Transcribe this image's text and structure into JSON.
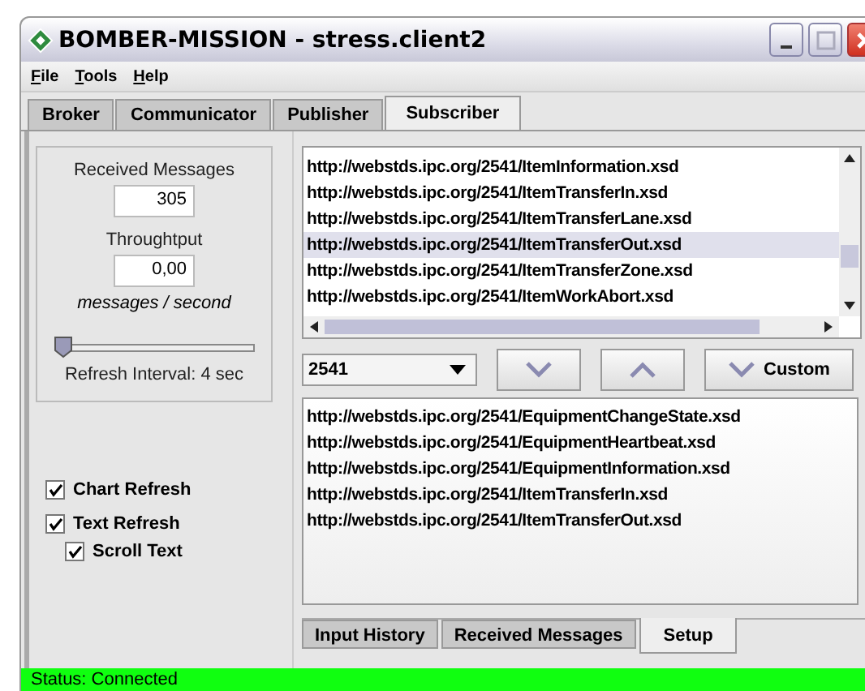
{
  "window": {
    "title": "BOMBER-MISSION - stress.client2"
  },
  "menu": [
    {
      "label": "File"
    },
    {
      "label": "Tools"
    },
    {
      "label": "Help"
    }
  ],
  "tabs": [
    {
      "label": "Broker",
      "selected": false
    },
    {
      "label": "Communicator",
      "selected": false
    },
    {
      "label": "Publisher",
      "selected": false
    },
    {
      "label": "Subscriber",
      "selected": true
    }
  ],
  "stats": {
    "received_label": "Received Messages",
    "received_value": "305",
    "throughput_label": "Throughtput",
    "throughput_value": "0,00",
    "unit": "messages / second",
    "refresh_slider": {
      "level": 0.0
    },
    "refresh_label": "Refresh Interval: 4 sec"
  },
  "options": [
    {
      "label": "Chart Refresh",
      "checked": true,
      "nested": false
    },
    {
      "label": "Text Refresh",
      "checked": true,
      "nested": false
    },
    {
      "label": "Scroll Text",
      "checked": true,
      "nested": true
    }
  ],
  "schema_list": [
    {
      "text": "http://webstds.ipc.org/2541/ItemInformation.xsd",
      "selected": false
    },
    {
      "text": "http://webstds.ipc.org/2541/ItemTransferIn.xsd",
      "selected": false
    },
    {
      "text": "http://webstds.ipc.org/2541/ItemTransferLane.xsd",
      "selected": false
    },
    {
      "text": "http://webstds.ipc.org/2541/ItemTransferOut.xsd",
      "selected": true
    },
    {
      "text": "http://webstds.ipc.org/2541/ItemTransferZone.xsd",
      "selected": false
    },
    {
      "text": "http://webstds.ipc.org/2541/ItemWorkAbort.xsd",
      "selected": false
    }
  ],
  "standard_dropdown": {
    "value": "2541"
  },
  "custom_button": {
    "label": "Custom"
  },
  "subscribed_list": [
    "http://webstds.ipc.org/2541/EquipmentChangeState.xsd",
    "http://webstds.ipc.org/2541/EquipmentHeartbeat.xsd",
    "http://webstds.ipc.org/2541/EquipmentInformation.xsd",
    "http://webstds.ipc.org/2541/ItemTransferIn.xsd",
    "http://webstds.ipc.org/2541/ItemTransferOut.xsd"
  ],
  "bottom_tabs": [
    {
      "label": "Input History",
      "selected": false
    },
    {
      "label": "Received Messages",
      "selected": false
    },
    {
      "label": "Setup",
      "selected": true
    }
  ],
  "status_bar": "Status: Connected"
}
